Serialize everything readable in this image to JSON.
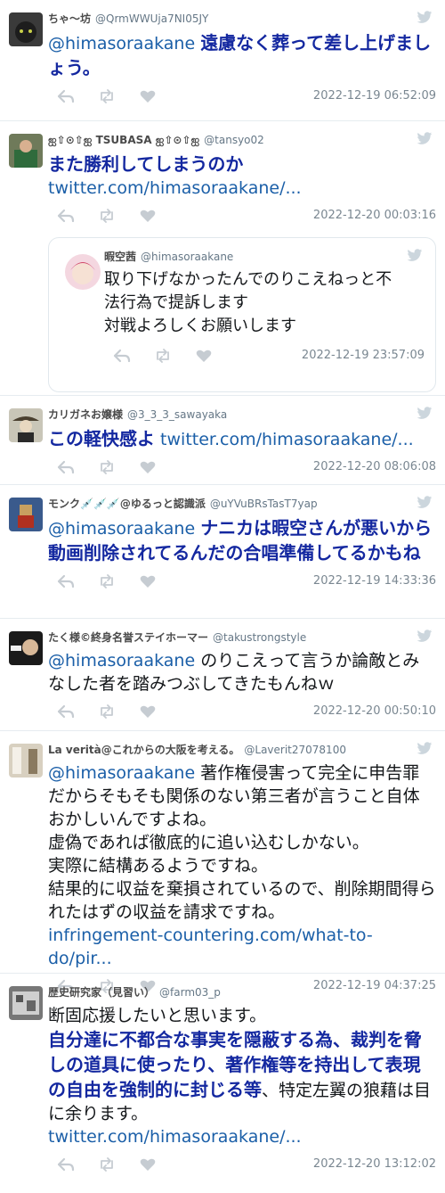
{
  "colors": {
    "accent_bold": "#1428a0",
    "link": "#1b5fa8",
    "meta": "#7a8791"
  },
  "tweets": [
    {
      "name": "ちゃ～坊",
      "handle": "@QrmWWUja7NI05JY",
      "mention": "@himasoraakane",
      "text": "遠慮なく葬って差し上げましょう。",
      "date": "2022-12-19 06:52:09"
    },
    {
      "name": "ஐ⇧⊙⇧ஐ TSUBASA ஐ⇧⊙⇧ஐ",
      "handle": "@tansyo02",
      "text": "また勝利してしまうのか",
      "link": "twitter.com/himasoraakane/...",
      "date": "2022-12-20 00:03:16",
      "quote": {
        "name": "暇空茜",
        "handle": "@himasoraakane",
        "text_1": "取り下げなかったんでのりこえねっと不",
        "text_2": "法行為で提訴します",
        "text_3": "対戦よろしくお願いします",
        "date": "2022-12-19 23:57:09"
      }
    },
    {
      "name": "カリガネお嬢様",
      "handle": "@3_3_3_sawayaka",
      "text": "この軽快感よ",
      "link": "twitter.com/himasoraakane/...",
      "date": "2022-12-20 08:06:08"
    },
    {
      "name": "モンク💉💉💉@ゆるっと認識派",
      "handle": "@uYVuBRsTasT7yap",
      "mention": "@himasoraakane",
      "text": "ナニカは暇空さんが悪いから動画削除されてるんだの合唱準備してるかもね",
      "date": "2022-12-19 14:33:36"
    },
    {
      "name": "たく様©終身名誉ステイホーマー",
      "handle": "@takustrongstyle",
      "mention": "@himasoraakane",
      "text": "のりこえって言うか論敵とみなした者を踏みつぶしてきたもんねｗ",
      "date": "2022-12-20 00:50:10"
    },
    {
      "name": "La verità@これからの大阪を考える。",
      "handle": "@Laverit27078100",
      "mention": "@himasoraakane",
      "text_1": "著作権侵害って完全に申告罪だからそもそも関係のない第三者が言うこと自体おかしいんですよね。",
      "text_2": "虚偽であれば徹底的に追い込むしかない。",
      "text_3": "実際に結構あるようですね。",
      "text_4": "結果的に収益を棄損されているので、削除期間得られたはずの収益を請求ですね。",
      "link": "infringement-countering.com/what-to-do/pir...",
      "date": "2022-12-19 04:37:25"
    },
    {
      "name": "歴史研究家（見習い）",
      "handle": "@farm03_p",
      "text_1": "断固応援したいと思います。",
      "text_bold": "自分達に不都合な事実を隠蔽する為、裁判を脅しの道具に使ったり、著作権等を持出して表現の自由を強制的に封じる等",
      "text_2": "、特定左翼の狼藉は目に余ります。",
      "link": "twitter.com/himasoraakane/...",
      "date": "2022-12-20 13:12:02"
    }
  ]
}
